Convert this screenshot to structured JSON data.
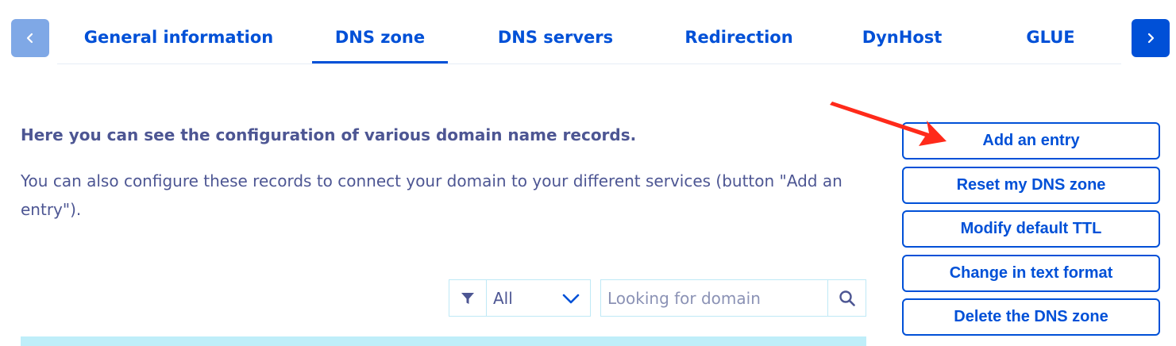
{
  "tabs": {
    "items": [
      {
        "label": "General information"
      },
      {
        "label": "DNS zone"
      },
      {
        "label": "DNS servers"
      },
      {
        "label": "Redirection"
      },
      {
        "label": "DynHost"
      },
      {
        "label": "GLUE"
      }
    ],
    "active_index": 1,
    "prev_icon": "chevron-left-icon",
    "next_icon": "chevron-right-icon"
  },
  "description": {
    "title": "Here you can see the configuration of various domain name records.",
    "body": "You can also configure these records to connect your domain to your different services (button \"Add an entry\")."
  },
  "actions": {
    "add_entry": "Add an entry",
    "reset_zone": "Reset my DNS zone",
    "modify_ttl": "Modify default TTL",
    "text_format": "Change in text format",
    "delete_zone": "Delete the DNS zone"
  },
  "filter": {
    "icon": "filter-icon",
    "selected": "All",
    "search_placeholder": "Looking for domain",
    "search_value": "",
    "search_icon": "search-icon"
  },
  "colors": {
    "primary": "#0050d7",
    "text": "#4d5693",
    "nav_disabled": "#7fa8e6",
    "border_light": "#bfe9f6",
    "annotation_arrow": "#ff2a1a"
  }
}
